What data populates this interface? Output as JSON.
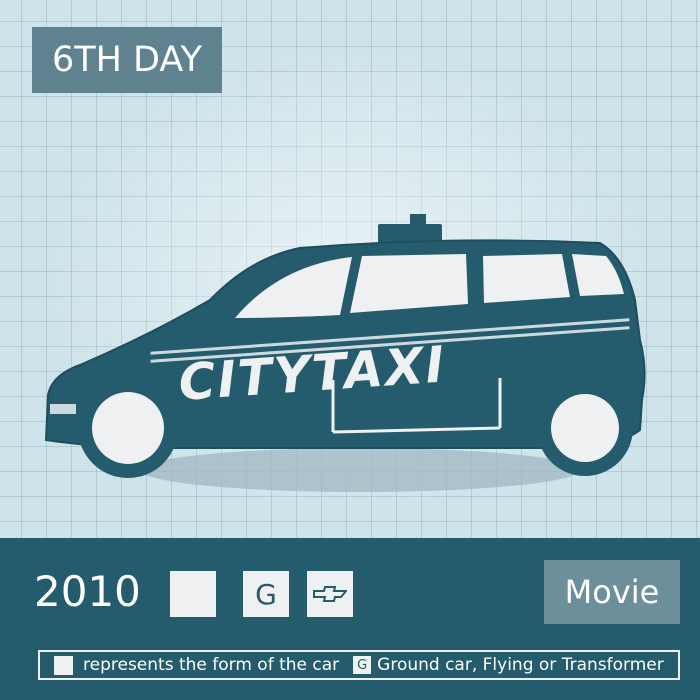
{
  "header": {
    "title": "6TH DAY"
  },
  "car": {
    "decal": "CITYTAXI",
    "body_color": "#245b6d",
    "window_color": "#eef0f1"
  },
  "info": {
    "year": "2010",
    "form_icon": "square-icon",
    "category_letter": "G",
    "brand_icon": "chevrolet-bowtie-icon",
    "type": "Movie"
  },
  "legend": {
    "form_text": "represents the form of the car",
    "category_letter": "G",
    "category_text": "Ground car, Flying or Transformer"
  },
  "colors": {
    "background": "#cfe3ea",
    "panel": "#245b6d",
    "badge": "#5f8190",
    "type_badge": "#6d8f9c"
  }
}
